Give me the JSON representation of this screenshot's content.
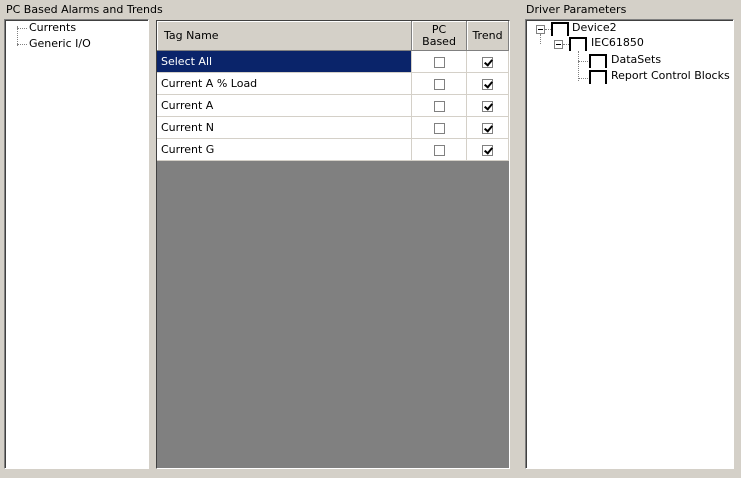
{
  "left_panel": {
    "title": "PC Based Alarms and Trends",
    "tree": [
      "Currents",
      "Generic I/O"
    ]
  },
  "grid": {
    "headers": {
      "name": "Tag Name",
      "pc_based": "PC\nBased",
      "trend": "Trend"
    },
    "rows": [
      {
        "name": "Select All",
        "pc_based": false,
        "trend": true,
        "selected": true
      },
      {
        "name": "Current A % Load",
        "pc_based": false,
        "trend": true,
        "selected": false
      },
      {
        "name": "Current A",
        "pc_based": false,
        "trend": true,
        "selected": false
      },
      {
        "name": "Current N",
        "pc_based": false,
        "trend": true,
        "selected": false
      },
      {
        "name": "Current G",
        "pc_based": false,
        "trend": true,
        "selected": false
      }
    ]
  },
  "right_panel": {
    "title": "Driver Parameters",
    "tree": {
      "root": "Device2",
      "child": "IEC61850",
      "leaves": [
        "DataSets",
        "Report Control Blocks"
      ]
    }
  },
  "colors": {
    "selection": "#0a246a",
    "background": "#d4d0c8",
    "grid_empty": "#808080"
  }
}
